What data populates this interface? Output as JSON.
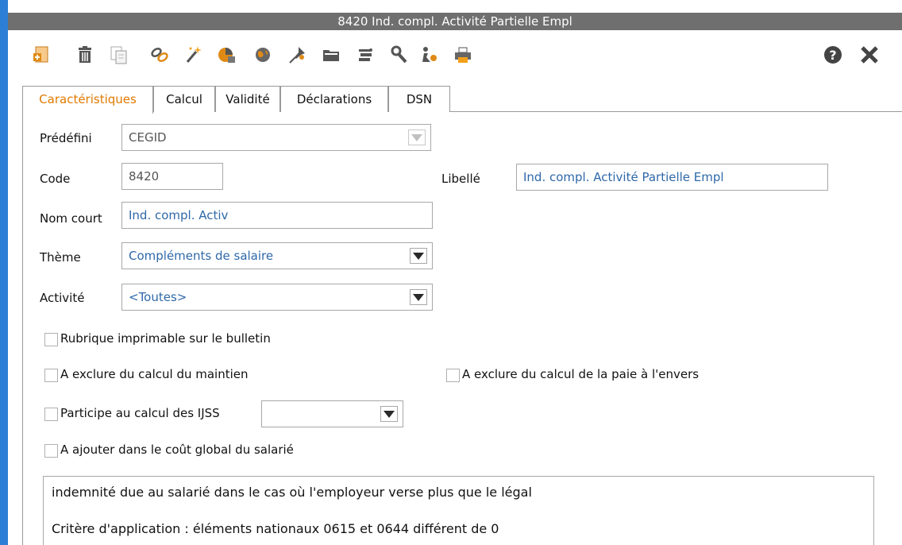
{
  "window": {
    "title": "8420 Ind. compl. Activité Partielle Empl"
  },
  "toolbar": {
    "icons": [
      "new-document-icon",
      "delete-icon",
      "copy-icon",
      "link-icon",
      "magic-wand-icon",
      "pie-chart-icon",
      "globe-icon",
      "pin-icon",
      "folder-icon",
      "wrench-icon",
      "tools-icon",
      "print-icon"
    ],
    "help_icon": "help-icon",
    "close_icon": "close-icon"
  },
  "tabs": [
    {
      "label": "Caractéristiques",
      "active": true
    },
    {
      "label": "Calcul",
      "active": false
    },
    {
      "label": "Validité",
      "active": false
    },
    {
      "label": "Déclarations",
      "active": false
    },
    {
      "label": "DSN",
      "active": false
    }
  ],
  "form": {
    "predefini": {
      "label": "Prédéfini",
      "value": "CEGID"
    },
    "code": {
      "label": "Code",
      "value": "8420"
    },
    "libelle": {
      "label": "Libellé",
      "value": "Ind. compl. Activité Partielle Empl"
    },
    "nom_court": {
      "label": "Nom court",
      "value": "Ind. compl. Activ"
    },
    "theme": {
      "label": "Thème",
      "value": "Compléments de salaire"
    },
    "activite": {
      "label": "Activité",
      "value": "<Toutes>"
    },
    "cb_imprimable": {
      "label": "Rubrique imprimable sur le bulletin",
      "checked": false
    },
    "cb_maintien": {
      "label": "A exclure du calcul du maintien",
      "checked": false
    },
    "cb_paie_envers": {
      "label": "A exclure du calcul de la paie à l'envers",
      "checked": false
    },
    "cb_ijss": {
      "label": "Participe au calcul des IJSS",
      "checked": false,
      "select_value": ""
    },
    "cb_cout_global": {
      "label": "A ajouter dans le coût global du salarié",
      "checked": false
    }
  },
  "memo": {
    "line1": "indemnité due au salarié dans le cas où l'employeur verse plus que le légal",
    "line2": "Critère d'application : éléments nationaux 0615 et 0644 différent de 0"
  },
  "colors": {
    "title_bg": "#6f6f6f",
    "accent_tab": "#e07a00",
    "field_text": "#2f68a8",
    "window_border": "#2d7fd6"
  }
}
